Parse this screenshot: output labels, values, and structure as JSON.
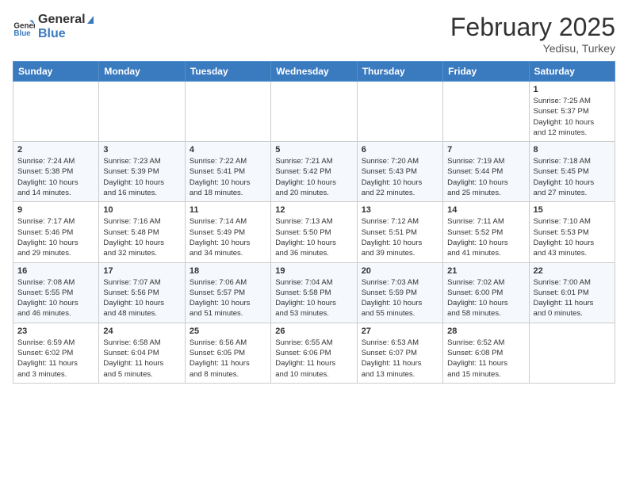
{
  "header": {
    "logo_general": "General",
    "logo_blue": "Blue",
    "month_year": "February 2025",
    "location": "Yedisu, Turkey"
  },
  "weekdays": [
    "Sunday",
    "Monday",
    "Tuesday",
    "Wednesday",
    "Thursday",
    "Friday",
    "Saturday"
  ],
  "weeks": [
    [
      {
        "day": "",
        "info": ""
      },
      {
        "day": "",
        "info": ""
      },
      {
        "day": "",
        "info": ""
      },
      {
        "day": "",
        "info": ""
      },
      {
        "day": "",
        "info": ""
      },
      {
        "day": "",
        "info": ""
      },
      {
        "day": "1",
        "info": "Sunrise: 7:25 AM\nSunset: 5:37 PM\nDaylight: 10 hours\nand 12 minutes."
      }
    ],
    [
      {
        "day": "2",
        "info": "Sunrise: 7:24 AM\nSunset: 5:38 PM\nDaylight: 10 hours\nand 14 minutes."
      },
      {
        "day": "3",
        "info": "Sunrise: 7:23 AM\nSunset: 5:39 PM\nDaylight: 10 hours\nand 16 minutes."
      },
      {
        "day": "4",
        "info": "Sunrise: 7:22 AM\nSunset: 5:41 PM\nDaylight: 10 hours\nand 18 minutes."
      },
      {
        "day": "5",
        "info": "Sunrise: 7:21 AM\nSunset: 5:42 PM\nDaylight: 10 hours\nand 20 minutes."
      },
      {
        "day": "6",
        "info": "Sunrise: 7:20 AM\nSunset: 5:43 PM\nDaylight: 10 hours\nand 22 minutes."
      },
      {
        "day": "7",
        "info": "Sunrise: 7:19 AM\nSunset: 5:44 PM\nDaylight: 10 hours\nand 25 minutes."
      },
      {
        "day": "8",
        "info": "Sunrise: 7:18 AM\nSunset: 5:45 PM\nDaylight: 10 hours\nand 27 minutes."
      }
    ],
    [
      {
        "day": "9",
        "info": "Sunrise: 7:17 AM\nSunset: 5:46 PM\nDaylight: 10 hours\nand 29 minutes."
      },
      {
        "day": "10",
        "info": "Sunrise: 7:16 AM\nSunset: 5:48 PM\nDaylight: 10 hours\nand 32 minutes."
      },
      {
        "day": "11",
        "info": "Sunrise: 7:14 AM\nSunset: 5:49 PM\nDaylight: 10 hours\nand 34 minutes."
      },
      {
        "day": "12",
        "info": "Sunrise: 7:13 AM\nSunset: 5:50 PM\nDaylight: 10 hours\nand 36 minutes."
      },
      {
        "day": "13",
        "info": "Sunrise: 7:12 AM\nSunset: 5:51 PM\nDaylight: 10 hours\nand 39 minutes."
      },
      {
        "day": "14",
        "info": "Sunrise: 7:11 AM\nSunset: 5:52 PM\nDaylight: 10 hours\nand 41 minutes."
      },
      {
        "day": "15",
        "info": "Sunrise: 7:10 AM\nSunset: 5:53 PM\nDaylight: 10 hours\nand 43 minutes."
      }
    ],
    [
      {
        "day": "16",
        "info": "Sunrise: 7:08 AM\nSunset: 5:55 PM\nDaylight: 10 hours\nand 46 minutes."
      },
      {
        "day": "17",
        "info": "Sunrise: 7:07 AM\nSunset: 5:56 PM\nDaylight: 10 hours\nand 48 minutes."
      },
      {
        "day": "18",
        "info": "Sunrise: 7:06 AM\nSunset: 5:57 PM\nDaylight: 10 hours\nand 51 minutes."
      },
      {
        "day": "19",
        "info": "Sunrise: 7:04 AM\nSunset: 5:58 PM\nDaylight: 10 hours\nand 53 minutes."
      },
      {
        "day": "20",
        "info": "Sunrise: 7:03 AM\nSunset: 5:59 PM\nDaylight: 10 hours\nand 55 minutes."
      },
      {
        "day": "21",
        "info": "Sunrise: 7:02 AM\nSunset: 6:00 PM\nDaylight: 10 hours\nand 58 minutes."
      },
      {
        "day": "22",
        "info": "Sunrise: 7:00 AM\nSunset: 6:01 PM\nDaylight: 11 hours\nand 0 minutes."
      }
    ],
    [
      {
        "day": "23",
        "info": "Sunrise: 6:59 AM\nSunset: 6:02 PM\nDaylight: 11 hours\nand 3 minutes."
      },
      {
        "day": "24",
        "info": "Sunrise: 6:58 AM\nSunset: 6:04 PM\nDaylight: 11 hours\nand 5 minutes."
      },
      {
        "day": "25",
        "info": "Sunrise: 6:56 AM\nSunset: 6:05 PM\nDaylight: 11 hours\nand 8 minutes."
      },
      {
        "day": "26",
        "info": "Sunrise: 6:55 AM\nSunset: 6:06 PM\nDaylight: 11 hours\nand 10 minutes."
      },
      {
        "day": "27",
        "info": "Sunrise: 6:53 AM\nSunset: 6:07 PM\nDaylight: 11 hours\nand 13 minutes."
      },
      {
        "day": "28",
        "info": "Sunrise: 6:52 AM\nSunset: 6:08 PM\nDaylight: 11 hours\nand 15 minutes."
      },
      {
        "day": "",
        "info": ""
      }
    ]
  ]
}
